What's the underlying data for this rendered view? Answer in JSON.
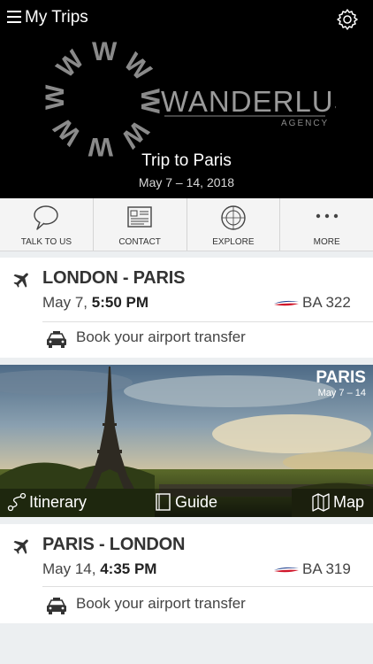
{
  "header": {
    "title": "My Trips",
    "logo_text": "WANDERLUST",
    "logo_sub": "AGENCY",
    "trip_title": "Trip to Paris",
    "trip_dates": "May 7 – 14, 2018"
  },
  "actions": [
    {
      "label": "TALK TO US",
      "icon": "chat-bubble-icon"
    },
    {
      "label": "CONTACT",
      "icon": "contact-card-icon"
    },
    {
      "label": "EXPLORE",
      "icon": "compass-icon"
    },
    {
      "label": "MORE",
      "icon": "more-dots-icon"
    }
  ],
  "flights": [
    {
      "route": "LONDON - PARIS",
      "date": "May 7,",
      "time": "5:50 PM",
      "flight": "BA 322",
      "transfer": "Book your airport transfer"
    },
    {
      "route": "PARIS - LONDON",
      "date": "May 14,",
      "time": "4:35 PM",
      "flight": "BA 319",
      "transfer": "Book your airport transfer"
    }
  ],
  "destination": {
    "city": "PARIS",
    "dates": "May 7 – 14",
    "links": [
      "Itinerary",
      "Guide",
      "Map"
    ]
  },
  "colors": {
    "header_bg": "#000000",
    "ba_blue": "#1b3c8c",
    "ba_red": "#d0172b"
  }
}
